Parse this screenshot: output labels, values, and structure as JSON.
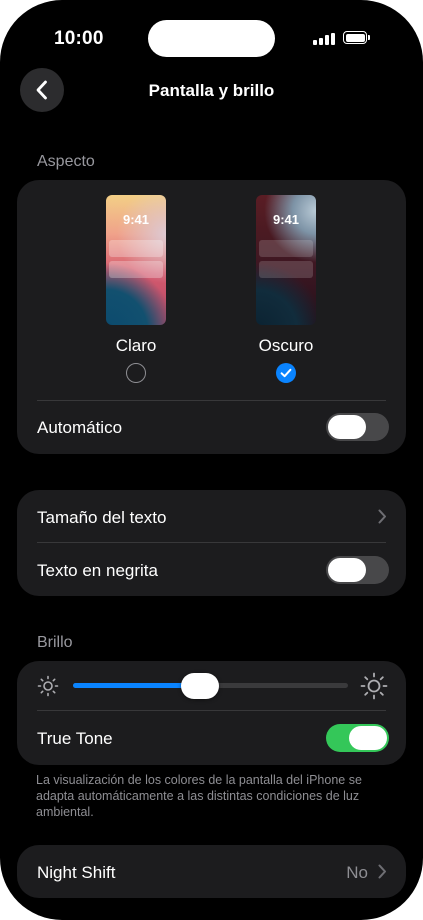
{
  "status_bar": {
    "time": "10:00"
  },
  "nav": {
    "title": "Pantalla y brillo",
    "back_icon": "chevron-left-icon"
  },
  "appearance": {
    "section_label": "Aspecto",
    "light": {
      "preview_time": "9:41",
      "label": "Claro",
      "selected": false
    },
    "dark": {
      "preview_time": "9:41",
      "label": "Oscuro",
      "selected": true
    },
    "automatic_label": "Automático",
    "automatic_on": false
  },
  "text": {
    "text_size_label": "Tamaño del texto",
    "bold_text_label": "Texto en negrita",
    "bold_text_on": false
  },
  "brightness": {
    "section_label": "Brillo",
    "level": 0.46,
    "true_tone_label": "True Tone",
    "true_tone_on": true,
    "footnote": "La visualización de los colores de la pantalla del iPhone se adapta automáticamente a las distintas condiciones de luz ambiental."
  },
  "night_shift": {
    "label": "Night Shift",
    "value": "No"
  },
  "colors": {
    "accent_blue": "#0a84ff",
    "toggle_on_green": "#34c759",
    "card_bg": "#1c1c1e",
    "screen_bg": "#000000"
  }
}
